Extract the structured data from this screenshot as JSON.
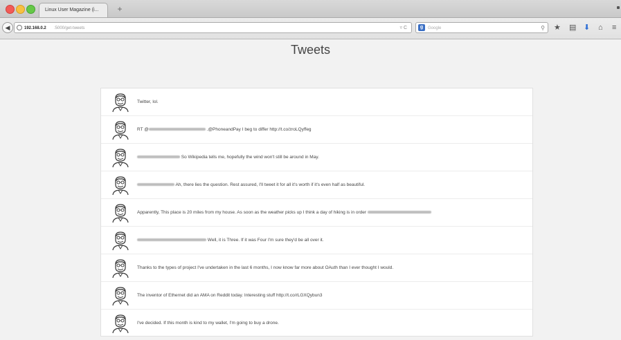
{
  "browser": {
    "tab_title": "Linux User Magazine (i...",
    "url_host": "192.168.0.2",
    "url_path": ":5000/get-tweets",
    "url_controls": "▿ C",
    "search_engine_letter": "g",
    "search_placeholder": "Google"
  },
  "page": {
    "title": "Tweets"
  },
  "tweets": [
    {
      "pre": "",
      "text": "Twitter, lol.",
      "post": ""
    },
    {
      "pre": "RT @",
      "text": " .@PhoneandPay I beg to differ http://t.co/zroLQyffeg",
      "post": ""
    },
    {
      "pre": "",
      "text": " So Wikipedia tells me, hopefully the wind won't still be around in May.",
      "post": ""
    },
    {
      "pre": "",
      "text": " Ah, there lies the question. Rest assured, I'll tweet it for all it's worth if it's even half as beautiful.",
      "post": ""
    },
    {
      "pre": "",
      "text": "Apparently, This place is 20 miles from my house. As soon as the weather picks up I think a day of hiking is in order ",
      "post": ""
    },
    {
      "pre": "",
      "text": " Well, it is Three. If it was Four I'm sure they'd be all over it.",
      "post": ""
    },
    {
      "pre": "",
      "text": "Thanks to the types of project I've undertaken in the last 6 months, I now know far more about OAuth than I ever thought I would.",
      "post": ""
    },
    {
      "pre": "",
      "text": "The inventor of Ethernet did an AMA on Reddit today. Interesting stuff http://t.co/rLGXQybun3",
      "post": ""
    },
    {
      "pre": "",
      "text": "I've decided. If this month is kind to my wallet, I'm going to buy a drone.",
      "post": ""
    }
  ],
  "icons": [
    "back-arrow-icon",
    "globe-icon",
    "reload-icon",
    "search-icon",
    "bookmark-star-icon",
    "clipboard-icon",
    "download-arrow-icon",
    "home-icon",
    "avatar-icon"
  ]
}
